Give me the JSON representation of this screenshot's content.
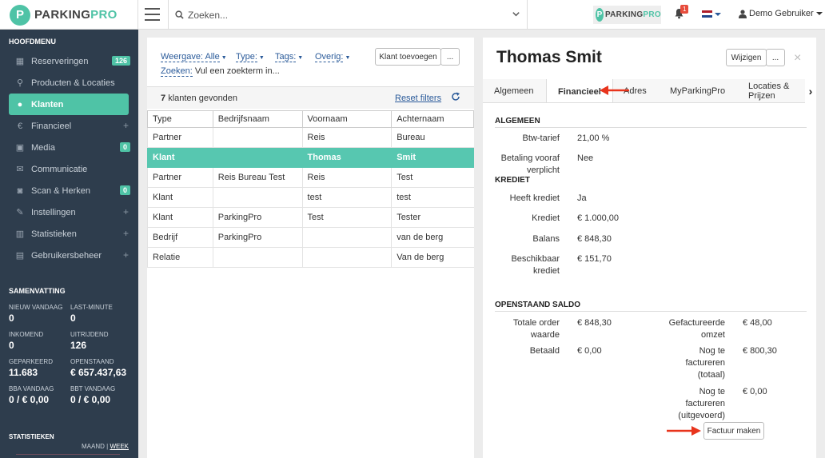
{
  "topbar": {
    "logo_p": "P",
    "logo_parking": "PARKING",
    "logo_pro": "PRO",
    "search_placeholder": "Zoeken...",
    "notifications_count": "1",
    "user_name": "Demo Gebruiker"
  },
  "sidebar": {
    "menu_heading": "HOOFDMENU",
    "items": [
      {
        "label": "Reserveringen",
        "icon": "calendar-icon",
        "badge": "126"
      },
      {
        "label": "Producten & Locaties",
        "icon": "map-pin-icon"
      },
      {
        "label": "Klanten",
        "icon": "user-icon",
        "active": true
      },
      {
        "label": "Financieel",
        "icon": "euro-icon",
        "plus": "+"
      },
      {
        "label": "Media",
        "icon": "image-icon",
        "badge": "0"
      },
      {
        "label": "Communicatie",
        "icon": "envelope-icon"
      },
      {
        "label": "Scan & Herken",
        "icon": "camera-icon",
        "badge": "0"
      },
      {
        "label": "Instellingen",
        "icon": "wrench-icon",
        "plus": "+"
      },
      {
        "label": "Statistieken",
        "icon": "bar-chart-icon",
        "plus": "+"
      },
      {
        "label": "Gebruikersbeheer",
        "icon": "lock-icon",
        "plus": "+"
      }
    ],
    "summary_heading": "SAMENVATTING",
    "summary": [
      {
        "label": "NIEUW VANDAAG",
        "value": "0"
      },
      {
        "label": "LAST-MINUTE",
        "value": "0"
      },
      {
        "label": "INKOMEND",
        "value": "0"
      },
      {
        "label": "UITRIJDEND",
        "value": "126"
      },
      {
        "label": "GEPARKEERD",
        "value": "11.683"
      },
      {
        "label": "OPENSTAAND",
        "value": "€ 657.437,63"
      },
      {
        "label": "BBA VANDAAG",
        "value": "0 / € 0,00"
      },
      {
        "label": "BBT VANDAAG",
        "value": "0 / € 0,00"
      }
    ],
    "stats_heading": "STATISTIEKEN",
    "stats_maand": "MAAND",
    "stats_sep": "|",
    "stats_week": "WEEK"
  },
  "list": {
    "filters": {
      "weergave": "Weergave: Alle",
      "type": "Type:",
      "tags": "Tags:",
      "overig": "Overig:",
      "zoeken_label": "Zoeken:",
      "zoeken_value": "Vul een zoekterm in..."
    },
    "add_button": "Klant toevoegen",
    "more_button": "...",
    "count_number": "7",
    "count_text": "klanten gevonden",
    "reset_filters": "Reset filters",
    "columns": [
      "Type",
      "Bedrijfsnaam",
      "Voornaam",
      "Achternaam"
    ],
    "rows": [
      [
        "Partner",
        "",
        "Reis",
        "Bureau"
      ],
      [
        "Klant",
        "",
        "Thomas",
        "Smit"
      ],
      [
        "Partner",
        "Reis Bureau Test",
        "Reis",
        "Test"
      ],
      [
        "Klant",
        "",
        "test",
        "test"
      ],
      [
        "Klant",
        "ParkingPro",
        "Test",
        "Tester"
      ],
      [
        "Bedrijf",
        "ParkingPro",
        "",
        "van de berg"
      ],
      [
        "Relatie",
        "",
        "",
        "Van de berg"
      ]
    ]
  },
  "detail": {
    "name": "Thomas Smit",
    "edit_button": "Wijzigen",
    "more_button": "...",
    "close": "×",
    "tabs": [
      "Algemeen",
      "Financieel",
      "Adres",
      "MyParkingPro",
      "Locaties & Prijzen"
    ],
    "section_algemeen": "ALGEMEEN",
    "btw_label": "Btw-tarief",
    "btw_value": "21,00 %",
    "betaling_label_1": "Betaling vooraf",
    "betaling_label_2": "verplicht",
    "betaling_value": "Nee",
    "section_krediet": "KREDIET",
    "heeft_krediet_label": "Heeft krediet",
    "heeft_krediet_value": "Ja",
    "krediet_label": "Krediet",
    "krediet_value": "€ 1.000,00",
    "balans_label": "Balans",
    "balans_value": "€ 848,30",
    "beschikbaar_label_1": "Beschikbaar",
    "beschikbaar_label_2": "krediet",
    "beschikbaar_value": "€ 151,70",
    "section_saldo": "OPENSTAAND SALDO",
    "totale_label_1": "Totale order",
    "totale_label_2": "waarde",
    "totale_value": "€ 848,30",
    "betaald_label": "Betaald",
    "betaald_value": "€ 0,00",
    "gefact_label_1": "Gefactureerde",
    "gefact_label_2": "omzet",
    "gefact_value": "€ 48,00",
    "nog_totaal_1": "Nog te",
    "nog_totaal_2": "factureren",
    "nog_totaal_3": "(totaal)",
    "nog_totaal_value": "€ 800,30",
    "nog_uitg_1": "Nog te",
    "nog_uitg_2": "factureren",
    "nog_uitg_3": "(uitgevoerd)",
    "nog_uitg_value": "€ 0,00",
    "factuur_button": "Factuur maken"
  },
  "colors": {
    "accent": "#4fc3a6",
    "sidebar": "#2e3d4d",
    "link": "#2b5b9a",
    "annotation_arrow": "#e8341c"
  }
}
